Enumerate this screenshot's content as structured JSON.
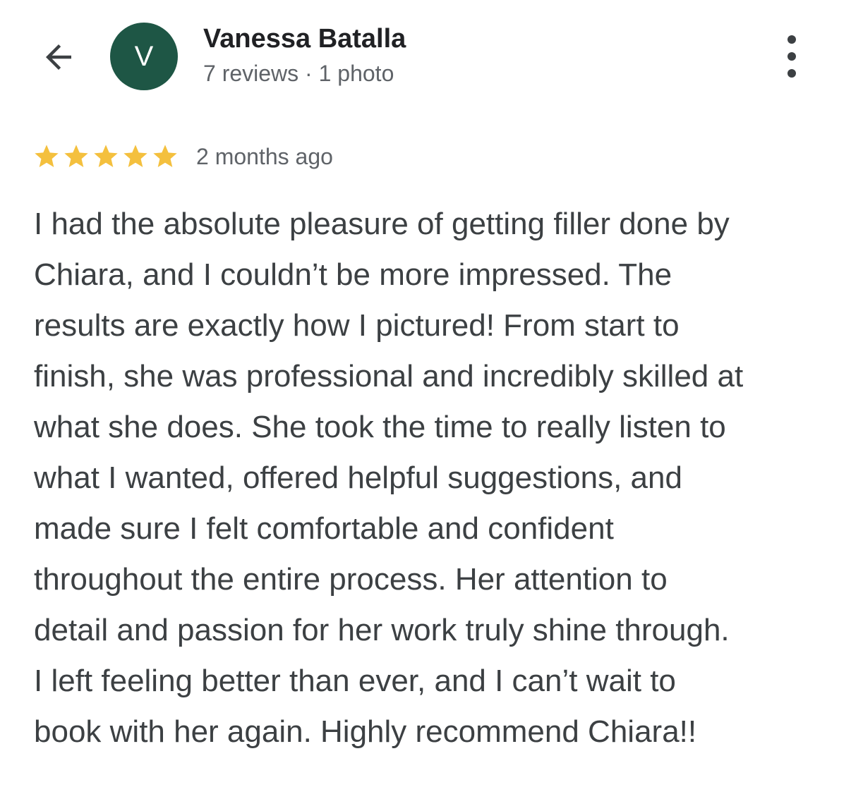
{
  "header": {
    "back_icon": "arrow-left-icon",
    "avatar_letter": "V",
    "avatar_color": "#1e5645",
    "reviewer_name": "Vanessa Batalla",
    "reviewer_meta": "7 reviews · 1 photo",
    "more_icon": "more-vert-icon"
  },
  "review": {
    "rating": 5,
    "rating_max": 5,
    "star_color": "#f4c03e",
    "date": "2 months ago",
    "lines": [
      "I had the absolute pleasure of getting filler done by",
      "Chiara, and I couldn’t be more impressed. The",
      "results are exactly how I pictured! From start to",
      "finish, she was professional and incredibly skilled at",
      "what she does. She took the time to really listen to",
      "what I wanted, offered helpful suggestions, and",
      "made sure I felt comfortable and confident",
      "throughout the entire process. Her attention to",
      "detail and passion for her work truly shine through.",
      "I left feeling better than ever, and I can’t wait to",
      "book with her again. Highly recommend Chiara!!"
    ]
  }
}
